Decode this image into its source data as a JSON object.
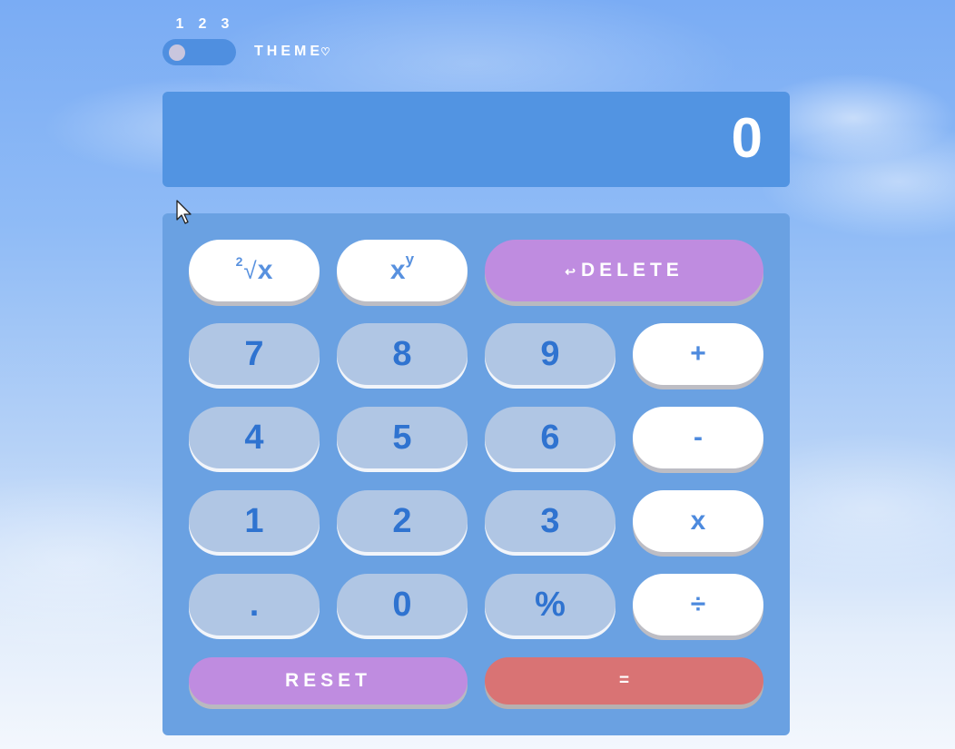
{
  "theme_switcher": {
    "numbers": [
      "1",
      "2",
      "3"
    ],
    "label": "THEME",
    "heart": "♡",
    "selected": 1
  },
  "display": {
    "value": "0"
  },
  "keys": {
    "sqrt": {
      "index": "2",
      "radical": "√",
      "x": "x"
    },
    "power": {
      "base": "x",
      "exp": "y"
    },
    "delete": {
      "icon": "↩",
      "label": "DELETE"
    },
    "seven": "7",
    "eight": "8",
    "nine": "9",
    "plus": "+",
    "four": "4",
    "five": "5",
    "six": "6",
    "minus": "-",
    "one": "1",
    "two": "2",
    "three": "3",
    "times": "x",
    "dot": ".",
    "zero": "0",
    "percent": "%",
    "divide": "÷",
    "reset": "RESET",
    "equals": "="
  },
  "colors": {
    "display_bg": "#5294e2",
    "keypad_bg": "#6aa1e2",
    "number_key": "#b0c6e4",
    "operator_key": "#ffffff",
    "accent_purple": "#bf8ce0",
    "accent_red": "#d97374"
  }
}
